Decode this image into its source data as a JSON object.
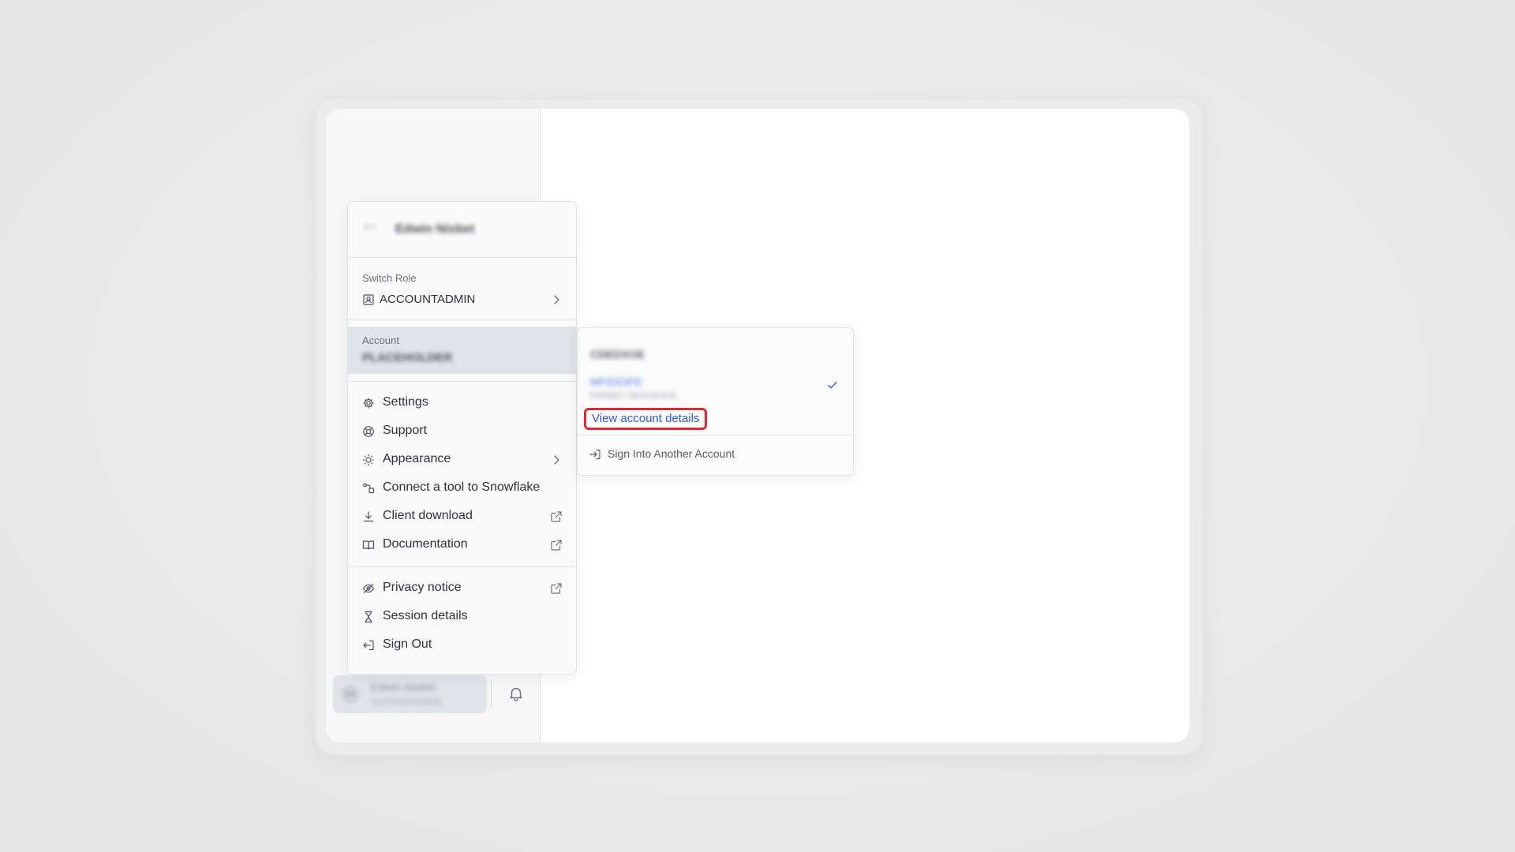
{
  "sidebar": {
    "user_chip": {
      "initials": "EN",
      "name": "Edwin Nisbet",
      "role": "ACCOUNTADMIN"
    }
  },
  "user_menu": {
    "header": {
      "initials": "EN",
      "name": "Edwin Nisbet"
    },
    "switch_role": {
      "label": "Switch Role",
      "current_role": "ACCOUNTADMIN"
    },
    "account": {
      "label": "Account",
      "value": "PLACEHOLDER"
    },
    "items": [
      {
        "label": "Settings",
        "icon": "gear-icon"
      },
      {
        "label": "Support",
        "icon": "lifebuoy-icon"
      },
      {
        "label": "Appearance",
        "icon": "sun-icon"
      },
      {
        "label": "Connect a tool to Snowflake",
        "icon": "connect-icon"
      },
      {
        "label": "Client download",
        "icon": "download-icon"
      },
      {
        "label": "Documentation",
        "icon": "book-icon"
      }
    ],
    "footer_items": [
      {
        "label": "Privacy notice",
        "icon": "eye-off-icon"
      },
      {
        "label": "Session details",
        "icon": "hourglass-icon"
      },
      {
        "label": "Sign Out",
        "icon": "sign-out-icon"
      }
    ]
  },
  "account_submenu": {
    "org_name": "CDEDXOE",
    "account_id": "MFIDDIFE",
    "account_region": "ERRBET DEOUEHUE",
    "view_details_label": "View account details",
    "sign_in_another_label": "Sign Into Another Account"
  },
  "colors": {
    "accent_link": "#2f5bd6",
    "highlight_box": "#e3262f",
    "selected_row": "#e1e3ea"
  }
}
